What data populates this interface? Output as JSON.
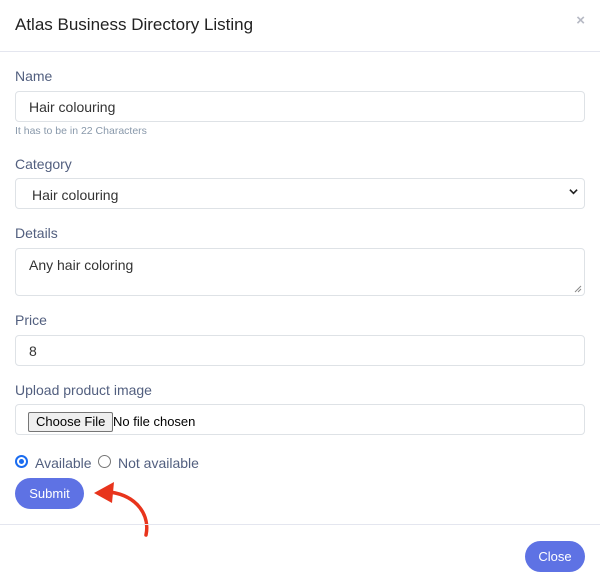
{
  "modal": {
    "title": "Atlas Business Directory Listing",
    "close_icon_glyph": "×"
  },
  "form": {
    "name": {
      "label": "Name",
      "value": "Hair colouring",
      "help": "It has to be in 22 Characters"
    },
    "category": {
      "label": "Category",
      "selected": "Hair colouring"
    },
    "details": {
      "label": "Details",
      "value": "Any hair coloring"
    },
    "price": {
      "label": "Price",
      "value": "8"
    },
    "image": {
      "label": "Upload product image",
      "button": "Choose File",
      "status": "No file chosen"
    },
    "availability": {
      "options": [
        "Available",
        "Not available"
      ],
      "selected": "Available"
    },
    "submit_label": "Submit"
  },
  "footer": {
    "close_label": "Close"
  },
  "colors": {
    "primary": "#5e72e4",
    "annotation_arrow": "#e8341c",
    "radio_checked": "#1a6cf0"
  },
  "icons": [
    "close-icon",
    "chevron-down-icon",
    "annotation-arrow-icon"
  ]
}
